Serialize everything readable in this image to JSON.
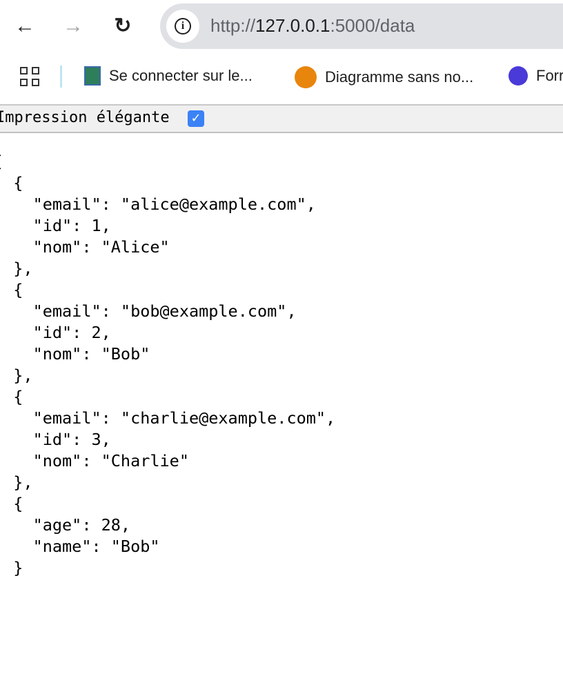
{
  "browser": {
    "url_scheme": "http://",
    "url_host": "127.0.0.1",
    "url_rest": ":5000/data",
    "bookmarks": [
      {
        "label": "Se connecter sur le...",
        "icon": "esme-icon"
      },
      {
        "label": "Diagramme sans no...",
        "icon": "drawio-icon"
      },
      {
        "label": "Forr",
        "icon": "forms-icon"
      }
    ]
  },
  "toolbar": {
    "pretty_print_label": "Impression élégante",
    "pretty_print_checked": true,
    "check_glyph": "✓"
  },
  "json_text": "[\n  {\n    \"email\": \"alice@example.com\",\n    \"id\": 1,\n    \"nom\": \"Alice\"\n  },\n  {\n    \"email\": \"bob@example.com\",\n    \"id\": 2,\n    \"nom\": \"Bob\"\n  },\n  {\n    \"email\": \"charlie@example.com\",\n    \"id\": 3,\n    \"nom\": \"Charlie\"\n  },\n  {\n    \"age\": 28,\n    \"name\": \"Bob\"\n  }\n]"
}
